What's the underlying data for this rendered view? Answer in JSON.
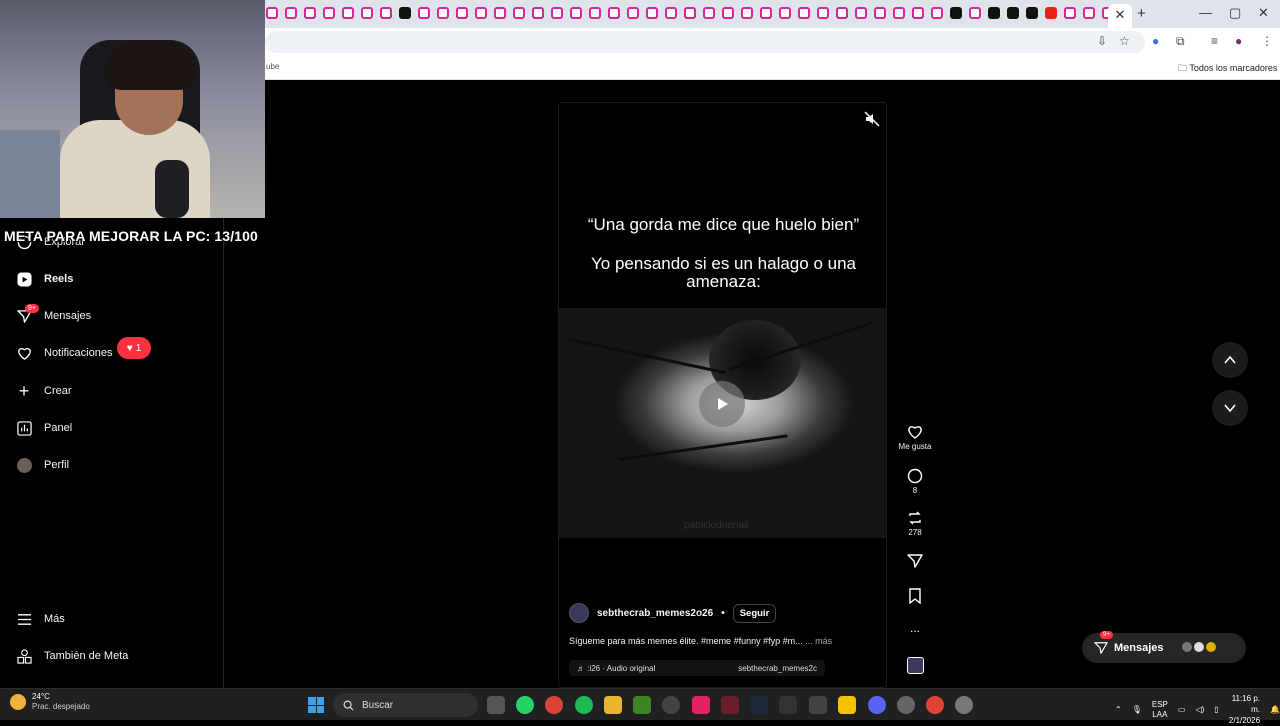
{
  "browser": {
    "tab_count_visible": 45,
    "bookmark_partial": "ube",
    "bookmarks_all": "Todos los marcadores",
    "window_controls": [
      "—",
      "▢",
      "✕"
    ],
    "new_tab": "+"
  },
  "stream": {
    "goal_text": "META PARA MEJORAR LA PC: 13/100"
  },
  "sidebar": {
    "items": [
      {
        "label": "Explorar",
        "icon": "compass-icon"
      },
      {
        "label": "Reels",
        "icon": "reels-icon",
        "active": true
      },
      {
        "label": "Mensajes",
        "icon": "messages-icon",
        "badge": "9+"
      },
      {
        "label": "Notificaciones",
        "icon": "heart-icon",
        "pill": "1"
      },
      {
        "label": "Crear",
        "icon": "plus-icon"
      },
      {
        "label": "Panel",
        "icon": "chart-icon"
      },
      {
        "label": "Perfil",
        "icon": "avatar"
      }
    ],
    "bottom": [
      {
        "label": "Más",
        "icon": "menu-icon"
      },
      {
        "label": "También de Meta",
        "icon": "meta-icon"
      }
    ]
  },
  "reel": {
    "quote_line1": "“Una gorda me dice que huelo bien”",
    "quote_line2": "Yo pensando si es un halago o una amenaza:",
    "watermark": "patricioduenaii",
    "username": "sebthecrab_memes2o26",
    "dot": "•",
    "follow": "Seguir",
    "caption": "Sígueme para más memes élite. #meme #funny #fyp #m...",
    "caption_more": "... más",
    "audio_label": "♬ :i26 · Audio original",
    "audio_user": "sebthecrab_memes2c"
  },
  "actions": {
    "like_label": "Me gusta",
    "comments": "8",
    "reposts": "278",
    "more": "..."
  },
  "messages_pill": {
    "label": "Mensajes",
    "badge": "9+"
  },
  "taskbar": {
    "temp": "24°C",
    "weather": "Prac. despejado",
    "search": "Buscar",
    "lang1": "ESP",
    "lang2": "LAA",
    "time": "11:16 p. m.",
    "date": "2/1/2026"
  },
  "colors": {
    "badge_red": "#ff3040",
    "ig_bg": "#000000",
    "taskbar": "#202020"
  }
}
